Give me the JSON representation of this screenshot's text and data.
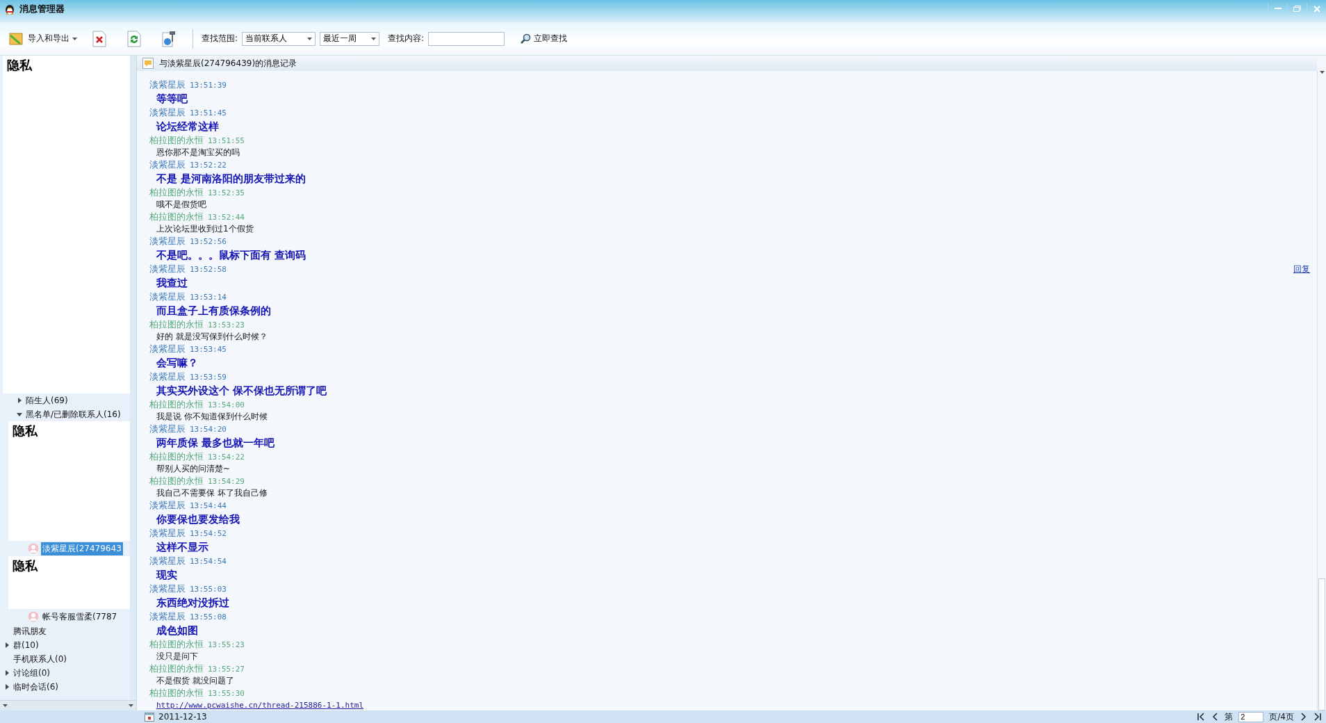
{
  "window": {
    "title": "消息管理器"
  },
  "toolbar": {
    "import_export": "导入和导出",
    "scope_label": "查找范围:",
    "scope_value": "当前联系人",
    "period_value": "最近一周",
    "content_label": "查找内容:",
    "search_button": "立即查找"
  },
  "sidebar": {
    "tree": [
      {
        "kind": "cover",
        "label": "隐私",
        "children": [
          {
            "kind": "group",
            "label": "陌生人(69)",
            "expanded": false
          },
          {
            "kind": "group",
            "label": "黑名单/已删除联系人(16)",
            "expanded": true,
            "children": [
              {
                "kind": "cover",
                "label": "隐私"
              },
              {
                "kind": "contact",
                "label": "淡紫星辰(27479643",
                "selected": true
              },
              {
                "kind": "cover",
                "label": "隐私"
              },
              {
                "kind": "contact",
                "label": "帐号客服雪柔(7787",
                "selected": false
              }
            ]
          }
        ]
      },
      {
        "kind": "group",
        "label": "腾讯朋友"
      },
      {
        "kind": "group",
        "label": "群(10)",
        "expanded": false
      },
      {
        "kind": "group",
        "label": "手机联系人(0)"
      },
      {
        "kind": "group",
        "label": "讨论组(0)",
        "expanded": false
      },
      {
        "kind": "group",
        "label": "临时会话(6)",
        "expanded": false
      }
    ]
  },
  "conversation": {
    "title": "与淡紫星辰(274796439)的消息记录",
    "messages": [
      {
        "sender": "淡紫星辰",
        "time": "13:51:39",
        "color": "#3b78b8",
        "kind": "bold",
        "text": "等等吧"
      },
      {
        "sender": "淡紫星辰",
        "time": "13:51:45",
        "color": "#3b78b8",
        "kind": "bold",
        "text": "论坛经常这样"
      },
      {
        "sender": "柏拉图的永恒",
        "time": "13:51:55",
        "color": "#55a87a",
        "kind": "plain",
        "text": "恩你那不是淘宝买的吗"
      },
      {
        "sender": "淡紫星辰",
        "time": "13:52:22",
        "color": "#3b78b8",
        "kind": "bold",
        "text": "不是 是河南洛阳的朋友带过来的"
      },
      {
        "sender": "柏拉图的永恒",
        "time": "13:52:35",
        "color": "#55a87a",
        "kind": "plain",
        "text": "哦不是假货吧"
      },
      {
        "sender": "柏拉图的永恒",
        "time": "13:52:44",
        "color": "#55a87a",
        "kind": "plain",
        "text": "上次论坛里收到过1个假货"
      },
      {
        "sender": "淡紫星辰",
        "time": "13:52:56",
        "color": "#3b78b8",
        "kind": "bold",
        "text": "不是吧。。。鼠标下面有 查询码"
      },
      {
        "sender": "淡紫星辰",
        "time": "13:52:58",
        "color": "#3b78b8",
        "kind": "bold",
        "text": "我查过",
        "reply": "回复"
      },
      {
        "sender": "淡紫星辰",
        "time": "13:53:14",
        "color": "#3b78b8",
        "kind": "bold",
        "text": "而且盒子上有质保条例的"
      },
      {
        "sender": "柏拉图的永恒",
        "time": "13:53:23",
        "color": "#55a87a",
        "kind": "plain",
        "text": "好的 就是没写保到什么时候？"
      },
      {
        "sender": "淡紫星辰",
        "time": "13:53:45",
        "color": "#3b78b8",
        "kind": "bold",
        "text": "会写嘛？"
      },
      {
        "sender": "淡紫星辰",
        "time": "13:53:59",
        "color": "#3b78b8",
        "kind": "bold",
        "text": "其实买外设这个 保不保也无所谓了吧"
      },
      {
        "sender": "柏拉图的永恒",
        "time": "13:54:00",
        "color": "#55a87a",
        "kind": "plain",
        "text": "我是说 你不知道保到什么时候"
      },
      {
        "sender": "淡紫星辰",
        "time": "13:54:20",
        "color": "#3b78b8",
        "kind": "bold",
        "text": "两年质保 最多也就一年吧"
      },
      {
        "sender": "柏拉图的永恒",
        "time": "13:54:22",
        "color": "#55a87a",
        "kind": "plain",
        "text": "帮别人买的问清楚~"
      },
      {
        "sender": "柏拉图的永恒",
        "time": "13:54:29",
        "color": "#55a87a",
        "kind": "plain",
        "text": "我自己不需要保 坏了我自己修"
      },
      {
        "sender": "淡紫星辰",
        "time": "13:54:44",
        "color": "#3b78b8",
        "kind": "bold",
        "text": "你要保也要发给我"
      },
      {
        "sender": "淡紫星辰",
        "time": "13:54:52",
        "color": "#3b78b8",
        "kind": "bold",
        "text": "这样不显示"
      },
      {
        "sender": "淡紫星辰",
        "time": "13:54:54",
        "color": "#3b78b8",
        "kind": "bold",
        "text": "现实"
      },
      {
        "sender": "淡紫星辰",
        "time": "13:55:03",
        "color": "#3b78b8",
        "kind": "bold",
        "text": "东西绝对没拆过"
      },
      {
        "sender": "淡紫星辰",
        "time": "13:55:08",
        "color": "#3b78b8",
        "kind": "bold",
        "text": "成色如图"
      },
      {
        "sender": "柏拉图的永恒",
        "time": "13:55:23",
        "color": "#55a87a",
        "kind": "plain",
        "text": "没只是问下"
      },
      {
        "sender": "柏拉图的永恒",
        "time": "13:55:27",
        "color": "#55a87a",
        "kind": "plain",
        "text": "不是假货 就没问题了"
      },
      {
        "sender": "柏拉图的永恒",
        "time": "13:55:30",
        "color": "#55a87a",
        "kind": "link",
        "text": "http://www.pcwaishe.cn/thread-215886-1-1.html"
      }
    ]
  },
  "status_bar": {
    "date": "2011-12-13",
    "page_prefix": "第",
    "page": "2",
    "page_suffix": "页/4页"
  }
}
